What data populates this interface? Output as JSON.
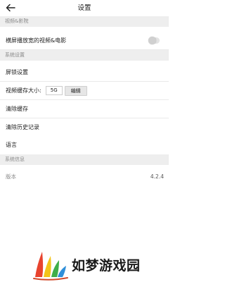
{
  "header": {
    "title": "设置",
    "back_icon": "arrow-left-icon"
  },
  "sections": {
    "video": {
      "title": "视频&影院",
      "items": {
        "landscape_wide": "横屏播放宽的视频&电影"
      },
      "toggle_on": false
    },
    "system_settings": {
      "title": "系统设置",
      "lock_screen": "屏锁设置",
      "cache_size_label": "视频缓存大小:",
      "cache_size_value": "5G",
      "edit_label": "编辑",
      "clear_cache": "清除缓存",
      "clear_history": "清除历史记录",
      "language": "语言"
    },
    "system_info": {
      "title": "系统信息",
      "version_label": "版本",
      "version_value": "4.2.4"
    }
  },
  "watermark": {
    "text": "如梦游戏园"
  },
  "colors": {
    "section_bg": "#eeeeee",
    "section_text": "#8a8a8a",
    "logo_red": "#e8432e",
    "logo_blue": "#2f8fd9",
    "logo_green": "#3fae49",
    "logo_yellow": "#f3c419"
  }
}
